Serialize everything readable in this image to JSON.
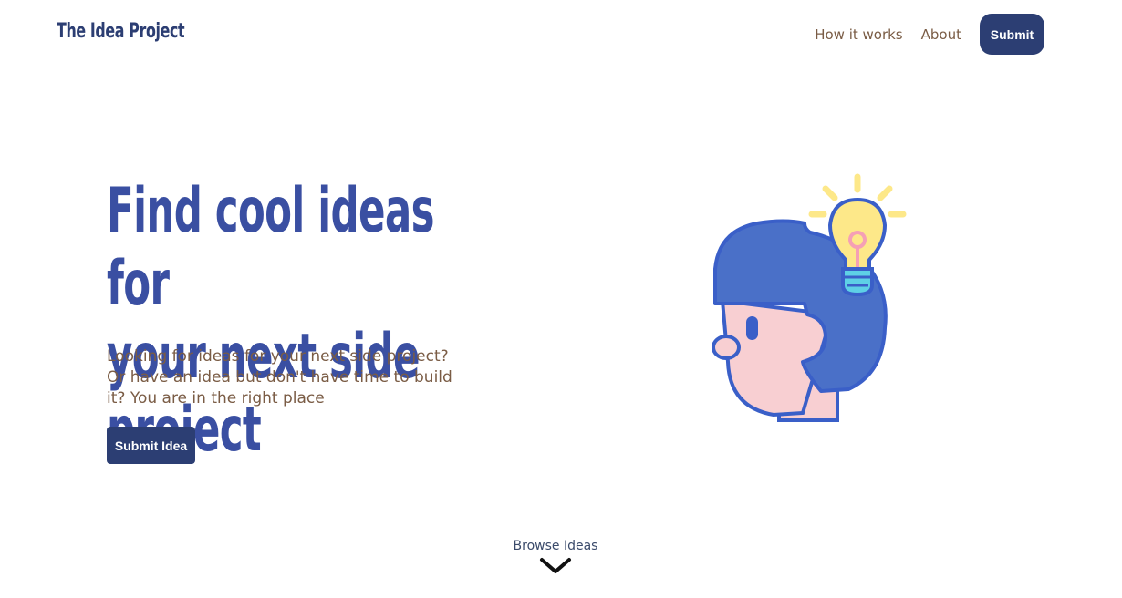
{
  "header": {
    "logo_text": "The Idea Project",
    "nav": {
      "how_it_works": "How it works",
      "about": "About",
      "submit": "Submit"
    }
  },
  "hero": {
    "title_line1": "Find cool ideas for",
    "title_line2": "your next side project",
    "description": "Looking for ideas for your next side project? Or have an idea but don't have time to build it? You are in the right place",
    "cta_label": "Submit Idea",
    "illustration_icon": "head-with-lightbulb-icon"
  },
  "browse": {
    "label": "Browse Ideas",
    "icon": "chevron-down-icon"
  },
  "colors": {
    "brand_dark": "#2c3e73",
    "title_blue": "#3a4fa2",
    "body_brown": "#7a5c45",
    "hair_blue": "#4a70c8",
    "skin_pink": "#f8cfd2",
    "bulb_yellow": "#fde889",
    "bulb_base_cyan": "#5ed0e6"
  }
}
